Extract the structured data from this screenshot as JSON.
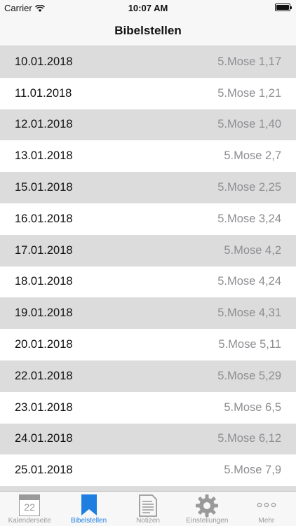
{
  "status_bar": {
    "carrier": "Carrier",
    "time": "10:07 AM"
  },
  "nav": {
    "title": "Bibelstellen"
  },
  "rows": [
    {
      "date": "10.01.2018",
      "reference": "5.Mose 1,17"
    },
    {
      "date": "11.01.2018",
      "reference": "5.Mose 1,21"
    },
    {
      "date": "12.01.2018",
      "reference": "5.Mose 1,40"
    },
    {
      "date": "13.01.2018",
      "reference": "5.Mose 2,7"
    },
    {
      "date": "15.01.2018",
      "reference": "5.Mose 2,25"
    },
    {
      "date": "16.01.2018",
      "reference": "5.Mose 3,24"
    },
    {
      "date": "17.01.2018",
      "reference": "5.Mose 4,2"
    },
    {
      "date": "18.01.2018",
      "reference": "5.Mose 4,24"
    },
    {
      "date": "19.01.2018",
      "reference": "5.Mose 4,31"
    },
    {
      "date": "20.01.2018",
      "reference": "5.Mose 5,11"
    },
    {
      "date": "22.01.2018",
      "reference": "5.Mose 5,29"
    },
    {
      "date": "23.01.2018",
      "reference": "5.Mose 6,5"
    },
    {
      "date": "24.01.2018",
      "reference": "5.Mose 6,12"
    },
    {
      "date": "25.01.2018",
      "reference": "5.Mose 7,9"
    }
  ],
  "tabs": [
    {
      "label": "Kalenderseite",
      "icon": "calendar-icon",
      "calendar_day": "22"
    },
    {
      "label": "Bibelstellen",
      "icon": "bookmark-icon"
    },
    {
      "label": "Notizen",
      "icon": "notes-icon"
    },
    {
      "label": "Einstellungen",
      "icon": "gear-icon"
    },
    {
      "label": "Mehr",
      "icon": "more-icon"
    }
  ],
  "colors": {
    "active_tab": "#1e7fe0",
    "inactive_tab": "#9a9a9a",
    "shaded_row": "#dcdcdc",
    "reference_text": "#8e8e93"
  }
}
